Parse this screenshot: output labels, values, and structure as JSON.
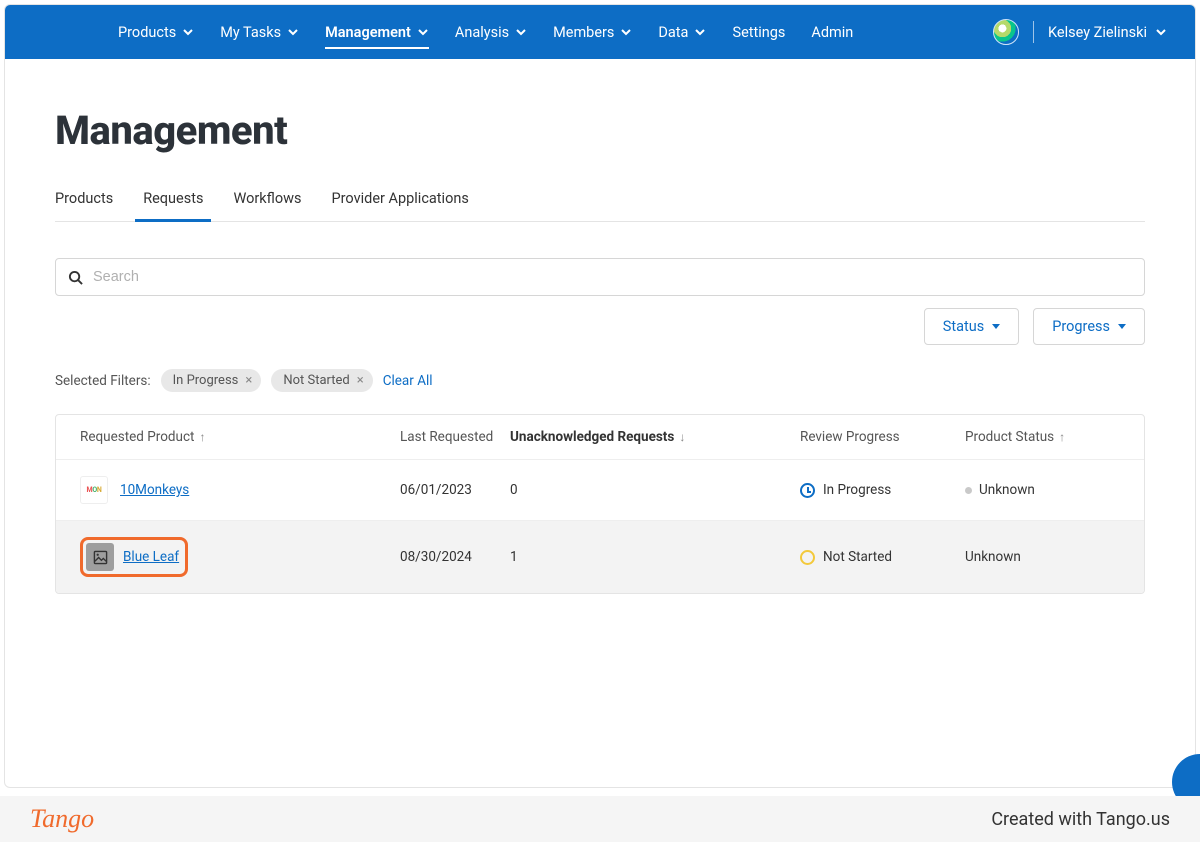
{
  "nav": {
    "items": [
      {
        "label": "Products",
        "caret": true
      },
      {
        "label": "My Tasks",
        "caret": true
      },
      {
        "label": "Management",
        "caret": true,
        "active": true
      },
      {
        "label": "Analysis",
        "caret": true
      },
      {
        "label": "Members",
        "caret": true
      },
      {
        "label": "Data",
        "caret": true
      },
      {
        "label": "Settings",
        "caret": false
      },
      {
        "label": "Admin",
        "caret": false
      }
    ],
    "user_name": "Kelsey Zielinski"
  },
  "page": {
    "title": "Management",
    "tabs": [
      "Products",
      "Requests",
      "Workflows",
      "Provider Applications"
    ],
    "active_tab": "Requests"
  },
  "search": {
    "placeholder": "Search",
    "value": ""
  },
  "filter_buttons": {
    "status": "Status",
    "progress": "Progress"
  },
  "selected_filters": {
    "label": "Selected Filters:",
    "chips": [
      "In Progress",
      "Not Started"
    ],
    "clear": "Clear All"
  },
  "table": {
    "columns": {
      "requested_product": "Requested Product",
      "last_requested": "Last Requested",
      "unack": "Unacknowledged Requests",
      "review_progress": "Review Progress",
      "product_status": "Product Status"
    },
    "rows": [
      {
        "product": "10Monkeys",
        "last": "06/01/2023",
        "unack": "0",
        "progress": "In Progress",
        "pstatus": "Unknown",
        "show_dot": true,
        "highlighted": false
      },
      {
        "product": "Blue Leaf",
        "last": "08/30/2024",
        "unack": "1",
        "progress": "Not Started",
        "pstatus": "Unknown",
        "show_dot": false,
        "highlighted": true
      }
    ]
  },
  "footer": {
    "brand": "Tango",
    "tagline": "Created with Tango.us"
  }
}
